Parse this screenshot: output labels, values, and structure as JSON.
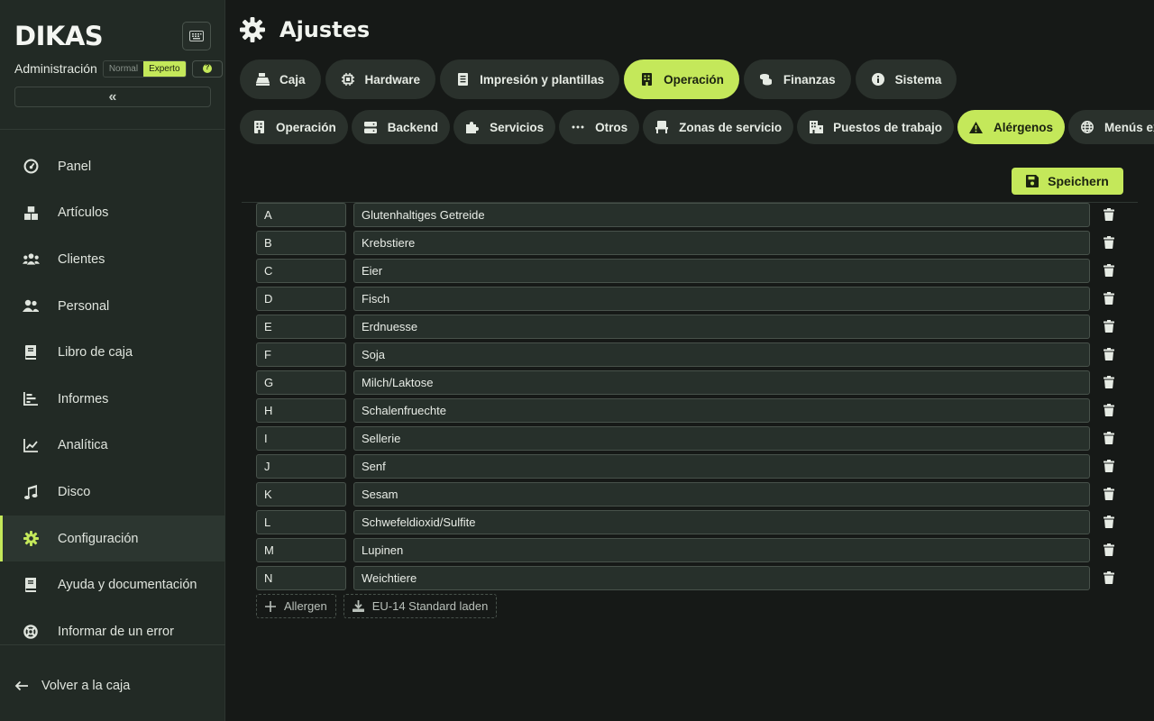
{
  "brand": {
    "logo_text": "DIKAS"
  },
  "sidebar": {
    "admin_label": "Administración",
    "modes": [
      "Normal",
      "Experto"
    ],
    "active_mode": "Experto",
    "collapse_glyph": "«",
    "items": [
      {
        "label": "Panel",
        "icon": "gauge-icon"
      },
      {
        "label": "Artículos",
        "icon": "boxes-icon"
      },
      {
        "label": "Clientes",
        "icon": "users-icon"
      },
      {
        "label": "Personal",
        "icon": "user-group-icon"
      },
      {
        "label": "Libro de caja",
        "icon": "book-icon"
      },
      {
        "label": "Informes",
        "icon": "bar-chart-icon"
      },
      {
        "label": "Analítica",
        "icon": "line-chart-icon"
      },
      {
        "label": "Disco",
        "icon": "music-icon"
      },
      {
        "label": "Configuración",
        "icon": "gear-icon",
        "active": true
      },
      {
        "label": "Ayuda y documentación",
        "icon": "book-icon"
      },
      {
        "label": "Informar de un error",
        "icon": "lifebuoy-icon"
      }
    ],
    "back_label": "Volver a la caja"
  },
  "header": {
    "title": "Ajustes"
  },
  "tabs_primary": [
    {
      "label": "Caja",
      "icon": "register-icon"
    },
    {
      "label": "Hardware",
      "icon": "chip-icon"
    },
    {
      "label": "Impresión y plantillas",
      "icon": "document-icon"
    },
    {
      "label": "Operación",
      "icon": "building-icon",
      "active": true
    },
    {
      "label": "Finanzas",
      "icon": "coins-icon"
    },
    {
      "label": "Sistema",
      "icon": "info-icon"
    }
  ],
  "tabs_secondary": [
    {
      "label": "Operación",
      "icon": "building-icon"
    },
    {
      "label": "Backend",
      "icon": "server-icon"
    },
    {
      "label": "Servicios",
      "icon": "puzzle-icon"
    },
    {
      "label": "Otros",
      "icon": "ellipsis-icon"
    },
    {
      "label": "Zonas de servicio",
      "icon": "chair-icon"
    },
    {
      "label": "Puestos de trabajo",
      "icon": "office-icon"
    },
    {
      "label": "Alérgenos",
      "icon": "warning-icon",
      "active": true
    },
    {
      "label": "Menús externos",
      "icon": "globe-icon"
    }
  ],
  "toolbar": {
    "save_label": "Speichern"
  },
  "allergens": [
    {
      "code": "A",
      "name": "Glutenhaltiges Getreide"
    },
    {
      "code": "B",
      "name": "Krebstiere"
    },
    {
      "code": "C",
      "name": "Eier"
    },
    {
      "code": "D",
      "name": "Fisch"
    },
    {
      "code": "E",
      "name": "Erdnuesse"
    },
    {
      "code": "F",
      "name": "Soja"
    },
    {
      "code": "G",
      "name": "Milch/Laktose"
    },
    {
      "code": "H",
      "name": "Schalenfruechte"
    },
    {
      "code": "I",
      "name": "Sellerie"
    },
    {
      "code": "J",
      "name": "Senf"
    },
    {
      "code": "K",
      "name": "Sesam"
    },
    {
      "code": "L",
      "name": "Schwefeldioxid/Sulfite"
    },
    {
      "code": "M",
      "name": "Lupinen"
    },
    {
      "code": "N",
      "name": "Weichtiere"
    }
  ],
  "actions": {
    "add_label": "Allergen",
    "load_standard_label": "EU-14 Standard laden"
  },
  "colors": {
    "accent": "#c4e85a",
    "background": "#161917",
    "sidebar": "#222a25",
    "tab": "#2a312c"
  }
}
